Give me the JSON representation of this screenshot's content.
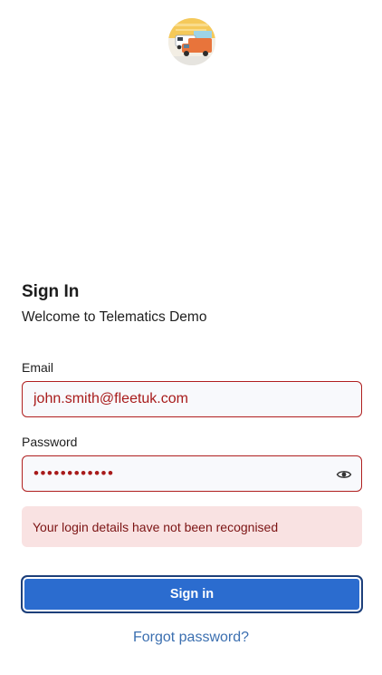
{
  "signin": {
    "title": "Sign In",
    "subtitle": "Welcome to Telematics Demo",
    "email": {
      "label": "Email",
      "value": "john.smith@fleetuk.com"
    },
    "password": {
      "label": "Password",
      "value": "••••••••••••"
    },
    "error_message": "Your login details have not been recognised",
    "submit_label": "Sign in",
    "forgot_link": "Forgot password?"
  },
  "colors": {
    "primary": "#2b6ccf",
    "error_border": "#b01f1f",
    "error_text": "#a81b1b",
    "alert_bg": "#f9e2e2",
    "link": "#3b6fb0"
  },
  "icons": {
    "logo": "fleet-vehicles-logo",
    "password_toggle": "eye-icon"
  }
}
